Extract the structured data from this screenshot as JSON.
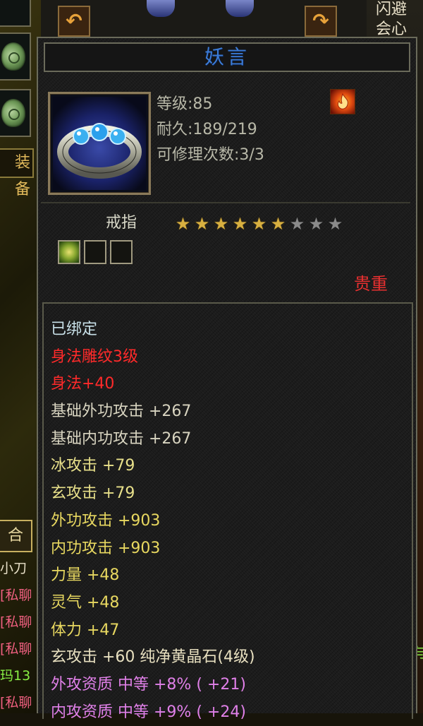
{
  "background": {
    "left_label": "装备",
    "hop_button": "合",
    "chat_lines": [
      {
        "text": "小刀",
        "color": "#e8e0c8"
      },
      {
        "text": "[私聊",
        "color": "#f06080"
      },
      {
        "text": "[私聊",
        "color": "#f06080"
      },
      {
        "text": "[私聊",
        "color": "#f06080"
      },
      {
        "text": "玛13",
        "color": "#88ee44"
      },
      {
        "text": "[私聊",
        "color": "#f06080"
      }
    ],
    "right_text": [
      "闪避",
      "会心"
    ],
    "right_green_text": "与"
  },
  "tooltip": {
    "title": "妖言",
    "level_label": "等级:85",
    "durability_label": "耐久:189/219",
    "repair_label": "可修理次数:3/3",
    "item_type": "戒指",
    "stars_filled": 6,
    "stars_total": 9,
    "gem_slots_filled": 1,
    "gem_slots_total": 3,
    "rarity": "贵重",
    "attributes": [
      {
        "text": "已绑定",
        "color": "#c8e0e8"
      },
      {
        "text": "身法雕纹3级",
        "color": "#ff2a2a"
      },
      {
        "text": "身法+40",
        "color": "#ff2a2a"
      },
      {
        "text": "基础外功攻击  +267",
        "color": "#d8d4c0"
      },
      {
        "text": "基础内功攻击  +267",
        "color": "#d8d4c0"
      },
      {
        "text": "冰攻击  +79",
        "color": "#e8e08a"
      },
      {
        "text": "玄攻击  +79",
        "color": "#e8e08a"
      },
      {
        "text": "外功攻击  +903",
        "color": "#e8d860"
      },
      {
        "text": "内功攻击  +903",
        "color": "#e8d860"
      },
      {
        "text": "力量  +48",
        "color": "#e8d860"
      },
      {
        "text": "灵气  +48",
        "color": "#e8d860"
      },
      {
        "text": "体力  +47",
        "color": "#e8d860"
      },
      {
        "text": "玄攻击  +60  纯净黄晶石(4级)",
        "color": "#e8e0c0"
      },
      {
        "text": "外攻资质   中等  +8% ( +21)",
        "color": "#e080e8"
      },
      {
        "text": "内攻资质   中等  +9% ( +24)",
        "color": "#e080e8"
      }
    ]
  },
  "colors": {
    "title": "#3c7cd8",
    "rarity": "#e83030",
    "star_on": "#d8b040",
    "star_off": "#8a8a8a"
  }
}
